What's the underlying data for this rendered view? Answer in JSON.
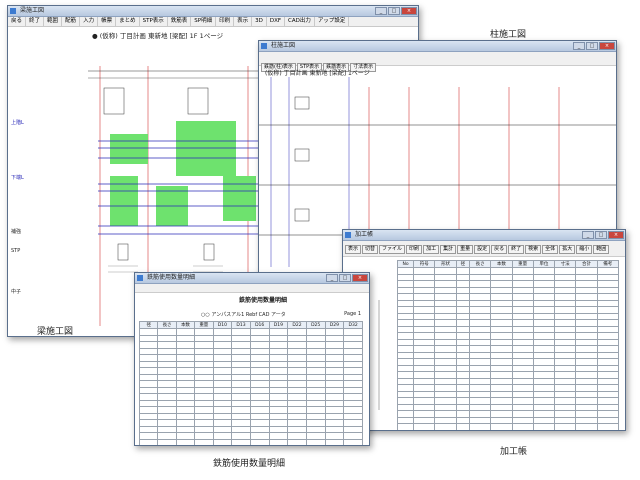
{
  "windows": {
    "beam": {
      "title": "梁施工図",
      "menu": [
        "戻る",
        "終了",
        "範囲",
        "配筋",
        "入力",
        "帳票",
        "まとめ",
        "STP表示",
        "鉄筋表",
        "SP明細",
        "印刷",
        "表示",
        "3D",
        "DXF",
        "CAD出力",
        "アップ設定"
      ],
      "header": "● (仮称) 丁目計画 東新地 [梁配]  1F  1ページ",
      "labels": {
        "top": "上階L",
        "mid": "下端L",
        "sub": "補強",
        "bottom": "中子",
        "stp": "STP"
      }
    },
    "column": {
      "title": "柱施工図",
      "header": "(仮称) 丁目計画 東新地 [梁配]  1ページ",
      "options": [
        "鉄筋(柱)表示",
        "STP表示",
        "鉄筋表示",
        "寸法表示"
      ]
    },
    "summary": {
      "title": "鉄筋使用数量明細",
      "heading": "鉄筋使用数量明細",
      "subheading": "○○ アンパスアル1 Rebf CAD アータ",
      "page": "Page 1",
      "total_label": "合計",
      "columns": [
        "径",
        "長さ",
        "本数",
        "重量",
        "D10",
        "D13",
        "D16",
        "D19",
        "D22",
        "D25",
        "D29",
        "D32"
      ]
    },
    "process": {
      "title": "加工帳",
      "toolbar": [
        "表示",
        "切替",
        "ファイル",
        "印刷",
        "加工",
        "集計",
        "重量",
        "設定",
        "戻る",
        "終了",
        "検索",
        "全体",
        "拡大",
        "縮小",
        "範囲",
        "出力",
        "帳票",
        "閉じる"
      ],
      "columns": [
        "No",
        "符号",
        "形状",
        "径",
        "長さ",
        "本数",
        "重量",
        "単位",
        "寸法",
        "合計",
        "備考"
      ]
    }
  },
  "captions": {
    "column": "柱施工図",
    "beam": "梁施工図",
    "summary": "鉄筋使用数量明細",
    "process": "加工帳"
  },
  "colors": {
    "accent": "#3d7bd0",
    "green": "#6ee26e",
    "grid": "#9aa3ae",
    "red": "#d23a3a"
  }
}
